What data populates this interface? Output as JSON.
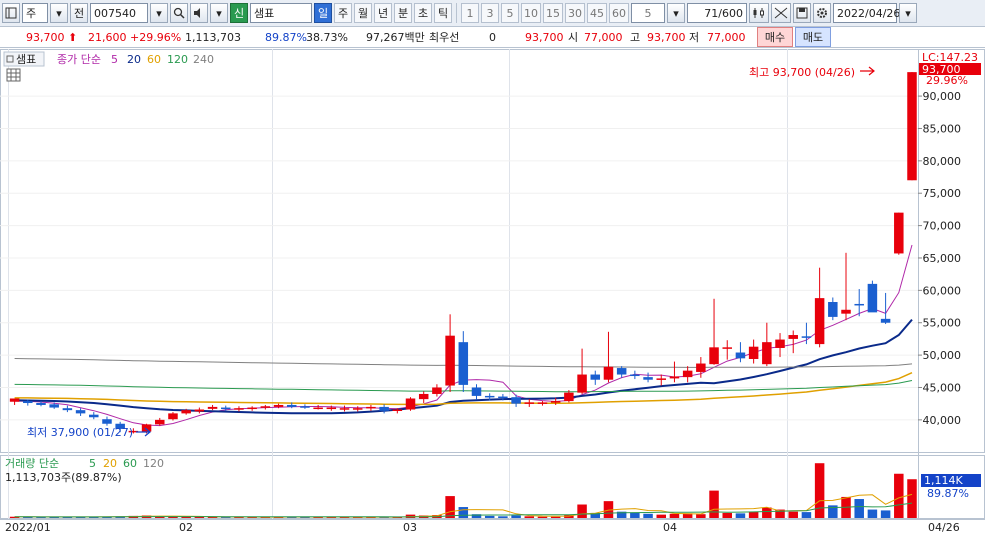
{
  "toolbar": {
    "market_type": "주",
    "view_type": "전",
    "code": "007540",
    "new_badge": "신",
    "name": "샘표",
    "periods": [
      "일",
      "주",
      "월",
      "년",
      "분",
      "초",
      "틱"
    ],
    "active_period": "일",
    "minute_options": [
      "1",
      "3",
      "5",
      "10",
      "15",
      "30",
      "45",
      "60"
    ],
    "custom_period": "5",
    "count_value": "71",
    "count_total": "/600",
    "date": "2022/04/26"
  },
  "info": {
    "price": "93,700",
    "change": "21,600",
    "change_rate": "+29.96%",
    "volume": "1,113,703",
    "volume_ratio": "89.87%",
    "turnover": "38.73%",
    "trade_amount": "97,267백만",
    "best_label": "최우선",
    "best_value": "0",
    "current": "93,700",
    "open_label": "시",
    "open": "77,000",
    "high_label": "고",
    "high": "93,700",
    "low_label": "저",
    "low": "77,000",
    "buy_label": "매수",
    "sell_label": "매도"
  },
  "price_panel": {
    "stock_tag": "샘표",
    "ma_title": "종가 단순",
    "ma_periods": [
      "5",
      "20",
      "60",
      "120",
      "240"
    ],
    "ma_colors": [
      "#b028a8",
      "#0a2a8a",
      "#e0a000",
      "#2a9a50",
      "#808080"
    ],
    "high_annotation": "최고 93,700 (04/26)",
    "low_annotation": "최저 37,900 (01/27)",
    "lc_label": "LC:147.23",
    "current_label": "93,700",
    "rate_label": "29.96%",
    "y_ticks": [
      "90,000",
      "85,000",
      "80,000",
      "75,000",
      "70,000",
      "65,000",
      "60,000",
      "55,000",
      "50,000",
      "45,000",
      "40,000"
    ]
  },
  "volume_panel": {
    "title": "거래량 단순",
    "ma_periods": [
      "5",
      "20",
      "60",
      "120"
    ],
    "ma_colors": [
      "#e0a000",
      "#2a9a50",
      "#808080"
    ],
    "volume_text": "1,113,703주(89.87%)",
    "vol_label": "1,114K",
    "vol_ratio_label": "89.87%"
  },
  "x_axis": {
    "labels": [
      "2022/01",
      "02",
      "03",
      "04"
    ],
    "right_label": "04/26"
  },
  "chart_data": {
    "type": "candlestick",
    "ylim": [
      35500,
      96500
    ],
    "candles": [
      {
        "o": 42800,
        "h": 43300,
        "l": 42300,
        "c": 43300,
        "v": 30
      },
      {
        "o": 42900,
        "h": 43100,
        "l": 42200,
        "c": 42600,
        "v": 25
      },
      {
        "o": 42600,
        "h": 42900,
        "l": 42100,
        "c": 42300,
        "v": 20
      },
      {
        "o": 42400,
        "h": 42700,
        "l": 41700,
        "c": 41900,
        "v": 25
      },
      {
        "o": 41800,
        "h": 42200,
        "l": 41200,
        "c": 41500,
        "v": 30
      },
      {
        "o": 41500,
        "h": 41800,
        "l": 40600,
        "c": 41000,
        "v": 25
      },
      {
        "o": 40800,
        "h": 41200,
        "l": 40100,
        "c": 40400,
        "v": 25
      },
      {
        "o": 40100,
        "h": 40500,
        "l": 39100,
        "c": 39400,
        "v": 35
      },
      {
        "o": 39400,
        "h": 39700,
        "l": 38100,
        "c": 38600,
        "v": 40
      },
      {
        "o": 38300,
        "h": 38700,
        "l": 37900,
        "c": 38300,
        "v": 50
      },
      {
        "o": 38200,
        "h": 39400,
        "l": 37900,
        "c": 39300,
        "v": 60
      },
      {
        "o": 39300,
        "h": 40300,
        "l": 39100,
        "c": 40000,
        "v": 40
      },
      {
        "o": 40100,
        "h": 41200,
        "l": 39900,
        "c": 41000,
        "v": 30
      },
      {
        "o": 41000,
        "h": 41700,
        "l": 40800,
        "c": 41500,
        "v": 30
      },
      {
        "o": 41300,
        "h": 41900,
        "l": 41000,
        "c": 41600,
        "v": 25
      },
      {
        "o": 41700,
        "h": 42300,
        "l": 41500,
        "c": 42000,
        "v": 30
      },
      {
        "o": 41900,
        "h": 42200,
        "l": 41400,
        "c": 41700,
        "v": 20
      },
      {
        "o": 41700,
        "h": 42100,
        "l": 41300,
        "c": 41800,
        "v": 20
      },
      {
        "o": 41800,
        "h": 42100,
        "l": 41400,
        "c": 41900,
        "v": 20
      },
      {
        "o": 41900,
        "h": 42300,
        "l": 41600,
        "c": 42100,
        "v": 20
      },
      {
        "o": 42000,
        "h": 42500,
        "l": 41800,
        "c": 42300,
        "v": 25
      },
      {
        "o": 42300,
        "h": 42700,
        "l": 41800,
        "c": 42000,
        "v": 30
      },
      {
        "o": 42100,
        "h": 42400,
        "l": 41700,
        "c": 42000,
        "v": 25
      },
      {
        "o": 41900,
        "h": 42300,
        "l": 41600,
        "c": 41900,
        "v": 20
      },
      {
        "o": 41800,
        "h": 42200,
        "l": 41400,
        "c": 41900,
        "v": 20
      },
      {
        "o": 41800,
        "h": 42200,
        "l": 41300,
        "c": 41800,
        "v": 25
      },
      {
        "o": 41700,
        "h": 42100,
        "l": 41300,
        "c": 41800,
        "v": 20
      },
      {
        "o": 41800,
        "h": 42300,
        "l": 41400,
        "c": 42000,
        "v": 20
      },
      {
        "o": 42000,
        "h": 42400,
        "l": 41000,
        "c": 41400,
        "v": 25
      },
      {
        "o": 41400,
        "h": 41800,
        "l": 41000,
        "c": 41600,
        "v": 20
      },
      {
        "o": 41600,
        "h": 43500,
        "l": 41400,
        "c": 43300,
        "v": 80
      },
      {
        "o": 43200,
        "h": 44400,
        "l": 42600,
        "c": 44000,
        "v": 60
      },
      {
        "o": 44000,
        "h": 45500,
        "l": 43600,
        "c": 45000,
        "v": 70
      },
      {
        "o": 45300,
        "h": 56300,
        "l": 44300,
        "c": 53000,
        "v": 520
      },
      {
        "o": 52000,
        "h": 53700,
        "l": 44300,
        "c": 45400,
        "v": 260
      },
      {
        "o": 45000,
        "h": 45500,
        "l": 43100,
        "c": 43700,
        "v": 90
      },
      {
        "o": 43700,
        "h": 44100,
        "l": 43000,
        "c": 43600,
        "v": 50
      },
      {
        "o": 43600,
        "h": 44000,
        "l": 43000,
        "c": 43400,
        "v": 40
      },
      {
        "o": 43500,
        "h": 43900,
        "l": 42000,
        "c": 42500,
        "v": 60
      },
      {
        "o": 42600,
        "h": 43200,
        "l": 42000,
        "c": 42700,
        "v": 40
      },
      {
        "o": 42600,
        "h": 42900,
        "l": 42200,
        "c": 42700,
        "v": 30
      },
      {
        "o": 42700,
        "h": 43400,
        "l": 42300,
        "c": 42900,
        "v": 30
      },
      {
        "o": 42900,
        "h": 44600,
        "l": 42700,
        "c": 44200,
        "v": 70
      },
      {
        "o": 44200,
        "h": 51000,
        "l": 44000,
        "c": 47000,
        "v": 320
      },
      {
        "o": 47000,
        "h": 47600,
        "l": 45400,
        "c": 46200,
        "v": 120
      },
      {
        "o": 46200,
        "h": 53600,
        "l": 45800,
        "c": 48200,
        "v": 400
      },
      {
        "o": 48000,
        "h": 48300,
        "l": 46500,
        "c": 47000,
        "v": 150
      },
      {
        "o": 47000,
        "h": 47600,
        "l": 46300,
        "c": 46800,
        "v": 120
      },
      {
        "o": 46600,
        "h": 47300,
        "l": 45800,
        "c": 46200,
        "v": 100
      },
      {
        "o": 46400,
        "h": 47000,
        "l": 45300,
        "c": 46400,
        "v": 80
      },
      {
        "o": 46400,
        "h": 49000,
        "l": 45800,
        "c": 46700,
        "v": 100
      },
      {
        "o": 46600,
        "h": 48300,
        "l": 45800,
        "c": 47600,
        "v": 110
      },
      {
        "o": 47400,
        "h": 49700,
        "l": 46500,
        "c": 48700,
        "v": 90
      },
      {
        "o": 48600,
        "h": 58700,
        "l": 48500,
        "c": 51200,
        "v": 650
      },
      {
        "o": 51000,
        "h": 52300,
        "l": 49300,
        "c": 51200,
        "v": 120
      },
      {
        "o": 50400,
        "h": 52000,
        "l": 48900,
        "c": 49500,
        "v": 110
      },
      {
        "o": 49400,
        "h": 52400,
        "l": 48700,
        "c": 51300,
        "v": 150
      },
      {
        "o": 48600,
        "h": 55000,
        "l": 48300,
        "c": 52000,
        "v": 250
      },
      {
        "o": 51100,
        "h": 53400,
        "l": 49700,
        "c": 52400,
        "v": 200
      },
      {
        "o": 52500,
        "h": 53800,
        "l": 50300,
        "c": 53100,
        "v": 150
      },
      {
        "o": 52900,
        "h": 55000,
        "l": 51700,
        "c": 52800,
        "v": 140
      },
      {
        "o": 51700,
        "h": 63500,
        "l": 51200,
        "c": 58800,
        "v": 1300
      },
      {
        "o": 58200,
        "h": 58900,
        "l": 55400,
        "c": 55900,
        "v": 300
      },
      {
        "o": 56400,
        "h": 65800,
        "l": 55400,
        "c": 57000,
        "v": 500
      },
      {
        "o": 57900,
        "h": 60200,
        "l": 56000,
        "c": 57700,
        "v": 450
      },
      {
        "o": 61000,
        "h": 61500,
        "l": 56800,
        "c": 56600,
        "v": 200
      },
      {
        "o": 55600,
        "h": 59600,
        "l": 54800,
        "c": 55000,
        "v": 180
      },
      {
        "o": 65700,
        "h": 72000,
        "l": 65500,
        "c": 72000,
        "v": 1050
      },
      {
        "o": 77000,
        "h": 93700,
        "l": 77000,
        "c": 93700,
        "v": 920
      }
    ],
    "ma5": [],
    "ma20": [],
    "volume_max": 1400
  }
}
